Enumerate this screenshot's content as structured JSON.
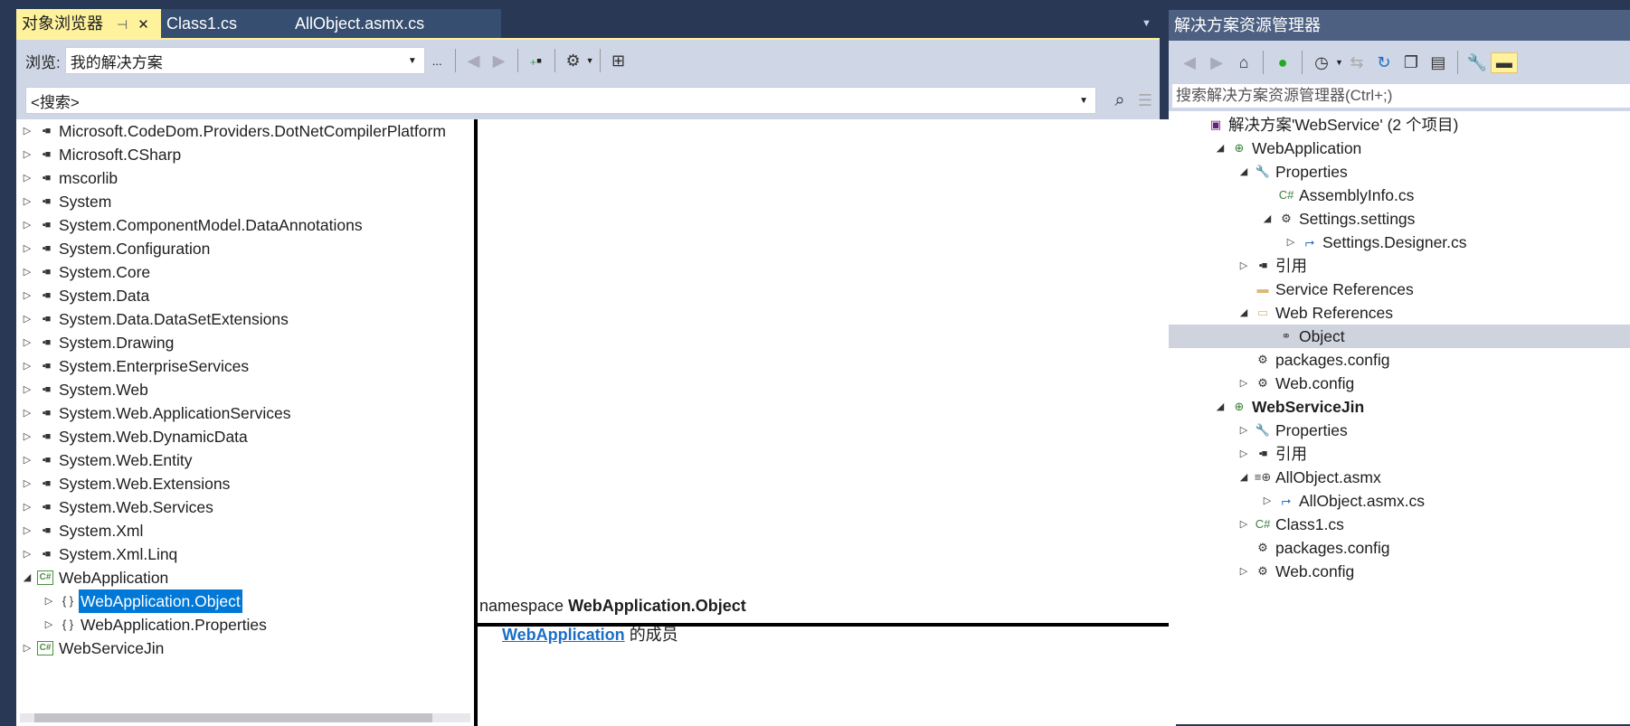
{
  "tabs": {
    "active": "对象浏览器",
    "pin": "⊣",
    "close": "✕",
    "others": [
      "Class1.cs",
      "AllObject.asmx.cs"
    ]
  },
  "object_browser": {
    "browse_label": "浏览:",
    "browse_value": "我的解决方案",
    "ellipsis": "...",
    "search_placeholder": "<搜索>",
    "tree": [
      {
        "level": 0,
        "exp": "▷",
        "icon": "ref",
        "text": "Microsoft.CodeDom.Providers.DotNetCompilerPlatform"
      },
      {
        "level": 0,
        "exp": "▷",
        "icon": "ref",
        "text": "Microsoft.CSharp"
      },
      {
        "level": 0,
        "exp": "▷",
        "icon": "ref",
        "text": "mscorlib"
      },
      {
        "level": 0,
        "exp": "▷",
        "icon": "ref",
        "text": "System"
      },
      {
        "level": 0,
        "exp": "▷",
        "icon": "ref",
        "text": "System.ComponentModel.DataAnnotations"
      },
      {
        "level": 0,
        "exp": "▷",
        "icon": "ref",
        "text": "System.Configuration"
      },
      {
        "level": 0,
        "exp": "▷",
        "icon": "ref",
        "text": "System.Core"
      },
      {
        "level": 0,
        "exp": "▷",
        "icon": "ref",
        "text": "System.Data"
      },
      {
        "level": 0,
        "exp": "▷",
        "icon": "ref",
        "text": "System.Data.DataSetExtensions"
      },
      {
        "level": 0,
        "exp": "▷",
        "icon": "ref",
        "text": "System.Drawing"
      },
      {
        "level": 0,
        "exp": "▷",
        "icon": "ref",
        "text": "System.EnterpriseServices"
      },
      {
        "level": 0,
        "exp": "▷",
        "icon": "ref",
        "text": "System.Web"
      },
      {
        "level": 0,
        "exp": "▷",
        "icon": "ref",
        "text": "System.Web.ApplicationServices"
      },
      {
        "level": 0,
        "exp": "▷",
        "icon": "ref",
        "text": "System.Web.DynamicData"
      },
      {
        "level": 0,
        "exp": "▷",
        "icon": "ref",
        "text": "System.Web.Entity"
      },
      {
        "level": 0,
        "exp": "▷",
        "icon": "ref",
        "text": "System.Web.Extensions"
      },
      {
        "level": 0,
        "exp": "▷",
        "icon": "ref",
        "text": "System.Web.Services"
      },
      {
        "level": 0,
        "exp": "▷",
        "icon": "ref",
        "text": "System.Xml"
      },
      {
        "level": 0,
        "exp": "▷",
        "icon": "ref",
        "text": "System.Xml.Linq"
      },
      {
        "level": 0,
        "exp": "◢",
        "icon": "cs",
        "text": "WebApplication"
      },
      {
        "level": 1,
        "exp": "▷",
        "icon": "ns",
        "text": "WebApplication.Object",
        "selected": true
      },
      {
        "level": 1,
        "exp": "▷",
        "icon": "ns",
        "text": "WebApplication.Properties"
      },
      {
        "level": 0,
        "exp": "▷",
        "icon": "cs",
        "text": "WebServiceJin"
      }
    ],
    "description": {
      "keyword": "namespace",
      "name": "WebApplication.Object",
      "link": "WebApplication",
      "member_of": "的成员"
    }
  },
  "solution_explorer": {
    "title": "解决方案资源管理器",
    "search_placeholder": "搜索解决方案资源管理器(Ctrl+;)",
    "tree": [
      {
        "level": 0,
        "exp": "",
        "icon": "solution",
        "text": "解决方案'WebService' (2 个项目)"
      },
      {
        "level": 1,
        "exp": "◢",
        "icon": "web",
        "text": "WebApplication"
      },
      {
        "level": 2,
        "exp": "◢",
        "icon": "wrench",
        "text": "Properties"
      },
      {
        "level": 3,
        "exp": "",
        "icon": "csfile",
        "text": "AssemblyInfo.cs"
      },
      {
        "level": 3,
        "exp": "◢",
        "icon": "gear",
        "text": "Settings.settings"
      },
      {
        "level": 4,
        "exp": "▷",
        "icon": "designer",
        "text": "Settings.Designer.cs"
      },
      {
        "level": 2,
        "exp": "▷",
        "icon": "ref",
        "text": "引用"
      },
      {
        "level": 2,
        "exp": "",
        "icon": "folder",
        "text": "Service References"
      },
      {
        "level": 2,
        "exp": "◢",
        "icon": "folder-open",
        "text": "Web References"
      },
      {
        "level": 3,
        "exp": "",
        "icon": "webref",
        "text": "Object",
        "selected": true
      },
      {
        "level": 2,
        "exp": "",
        "icon": "config",
        "text": "packages.config"
      },
      {
        "level": 2,
        "exp": "▷",
        "icon": "config",
        "text": "Web.config"
      },
      {
        "level": 1,
        "exp": "◢",
        "icon": "web",
        "text": "WebServiceJin",
        "bold": true
      },
      {
        "level": 2,
        "exp": "▷",
        "icon": "wrench",
        "text": "Properties"
      },
      {
        "level": 2,
        "exp": "▷",
        "icon": "ref",
        "text": "引用"
      },
      {
        "level": 2,
        "exp": "◢",
        "icon": "asmx",
        "text": "AllObject.asmx"
      },
      {
        "level": 3,
        "exp": "▷",
        "icon": "designer",
        "text": "AllObject.asmx.cs"
      },
      {
        "level": 2,
        "exp": "▷",
        "icon": "csfile",
        "text": "Class1.cs"
      },
      {
        "level": 2,
        "exp": "",
        "icon": "config",
        "text": "packages.config"
      },
      {
        "level": 2,
        "exp": "▷",
        "icon": "config",
        "text": "Web.config"
      }
    ]
  }
}
